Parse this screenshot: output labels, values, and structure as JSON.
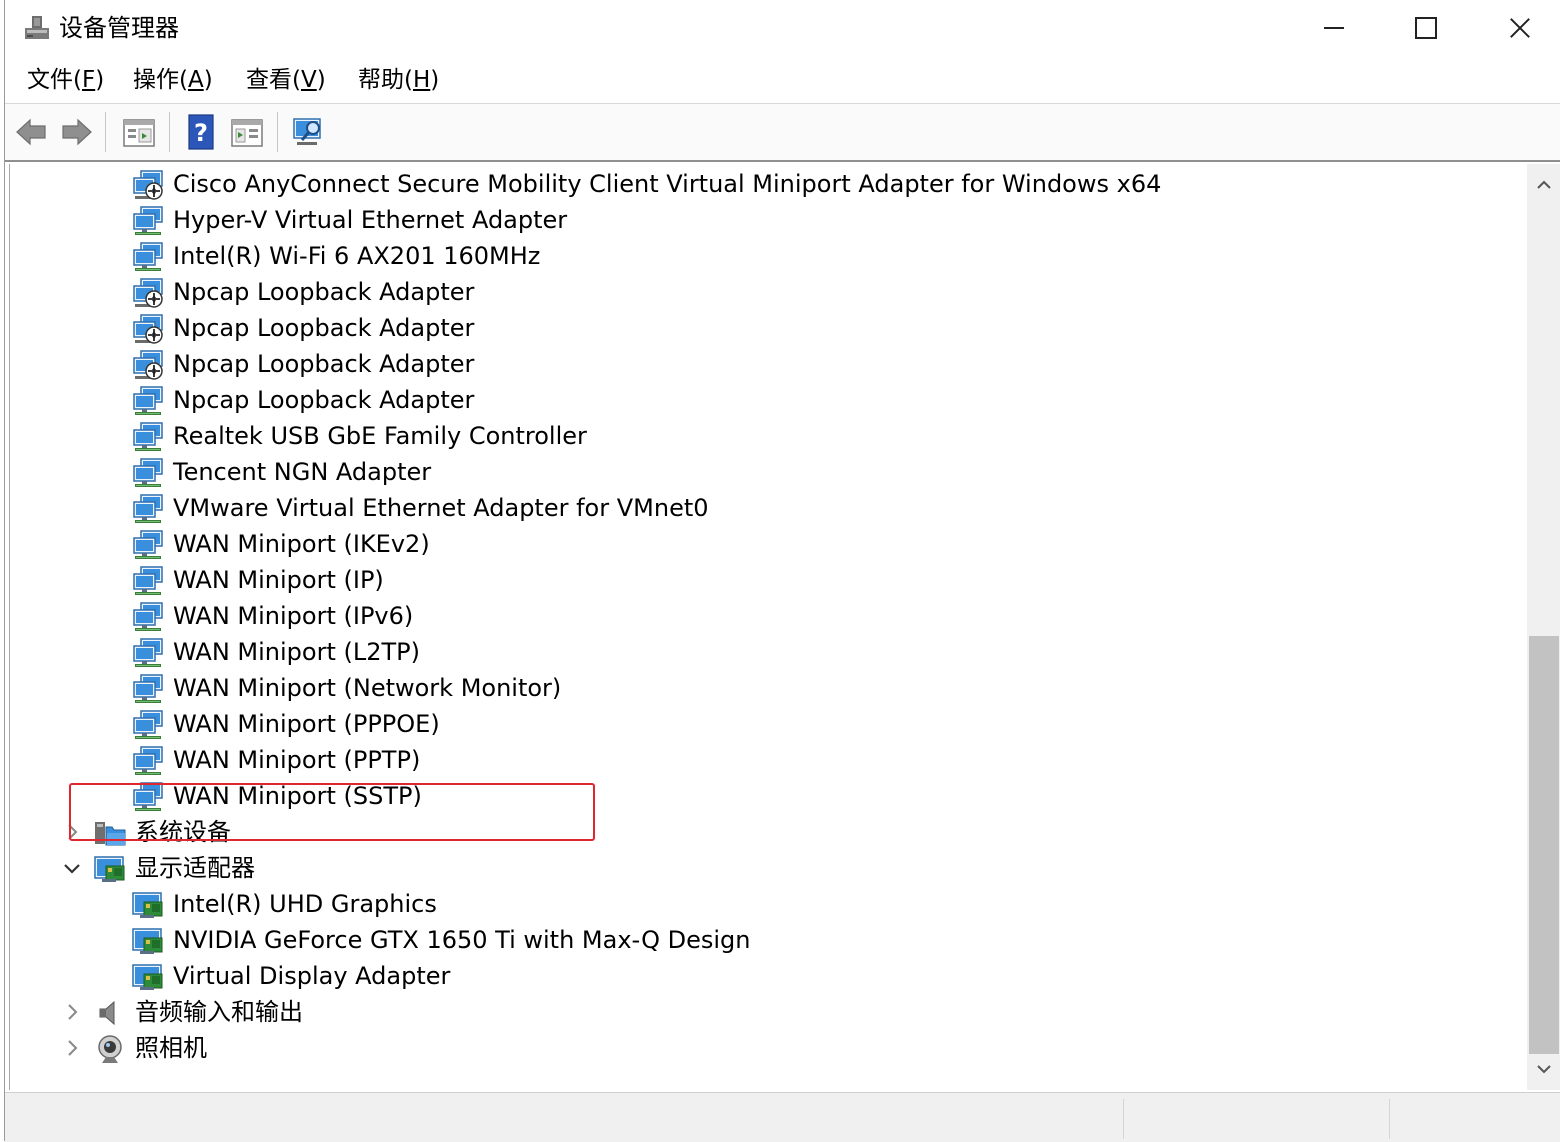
{
  "window": {
    "title": "设备管理器"
  },
  "menu": [
    {
      "text": "文件(",
      "key": "F",
      "end": ")"
    },
    {
      "text": "操作(",
      "key": "A",
      "end": ")"
    },
    {
      "text": "查看(",
      "key": "V",
      "end": ")"
    },
    {
      "text": "帮助(",
      "key": "H",
      "end": ")"
    }
  ],
  "toolbar": {
    "icons": [
      "back-arrow-icon",
      "forward-arrow-icon",
      "properties-icon",
      "help-icon",
      "update-driver-icon",
      "scan-hardware-icon"
    ]
  },
  "tree": {
    "network_adapters": [
      {
        "label": "Cisco AnyConnect Secure Mobility Client Virtual Miniport Adapter for Windows x64",
        "icon": "network-adapter-disabled-icon"
      },
      {
        "label": "Hyper-V Virtual Ethernet Adapter",
        "icon": "network-adapter-icon"
      },
      {
        "label": "Intel(R) Wi-Fi 6 AX201 160MHz",
        "icon": "network-adapter-icon"
      },
      {
        "label": "Npcap Loopback Adapter",
        "icon": "network-adapter-disabled-icon"
      },
      {
        "label": "Npcap Loopback Adapter",
        "icon": "network-adapter-disabled-icon"
      },
      {
        "label": "Npcap Loopback Adapter",
        "icon": "network-adapter-disabled-icon"
      },
      {
        "label": "Npcap Loopback Adapter",
        "icon": "network-adapter-icon"
      },
      {
        "label": "Realtek USB GbE Family Controller",
        "icon": "network-adapter-icon"
      },
      {
        "label": "Tencent NGN Adapter",
        "icon": "network-adapter-icon"
      },
      {
        "label": "VMware Virtual Ethernet Adapter for VMnet0",
        "icon": "network-adapter-icon"
      },
      {
        "label": "WAN Miniport (IKEv2)",
        "icon": "network-adapter-icon"
      },
      {
        "label": "WAN Miniport (IP)",
        "icon": "network-adapter-icon"
      },
      {
        "label": "WAN Miniport (IPv6)",
        "icon": "network-adapter-icon"
      },
      {
        "label": "WAN Miniport (L2TP)",
        "icon": "network-adapter-icon"
      },
      {
        "label": "WAN Miniport (Network Monitor)",
        "icon": "network-adapter-icon"
      },
      {
        "label": "WAN Miniport (PPPOE)",
        "icon": "network-adapter-icon"
      },
      {
        "label": "WAN Miniport (PPTP)",
        "icon": "network-adapter-icon"
      },
      {
        "label": "WAN Miniport (SSTP)",
        "icon": "network-adapter-icon"
      }
    ],
    "system_devices": {
      "label": "系统设备",
      "expanded": false,
      "icon": "system-devices-icon"
    },
    "display_adapters": {
      "label": "显示适配器",
      "expanded": true,
      "icon": "display-adapter-icon",
      "children": [
        {
          "label": "Intel(R) UHD Graphics",
          "icon": "display-adapter-icon"
        },
        {
          "label": "NVIDIA GeForce GTX 1650 Ti with Max-Q Design",
          "icon": "display-adapter-icon"
        },
        {
          "label": "Virtual Display Adapter",
          "icon": "display-adapter-icon",
          "highlighted": true
        }
      ]
    },
    "audio": {
      "label": "音频输入和输出",
      "expanded": false,
      "icon": "speaker-icon"
    },
    "camera": {
      "label": "照相机",
      "expanded": false,
      "icon": "camera-icon"
    }
  },
  "colors": {
    "highlight_border": "#e0262e",
    "monitor_blue": "#2f86d4"
  }
}
